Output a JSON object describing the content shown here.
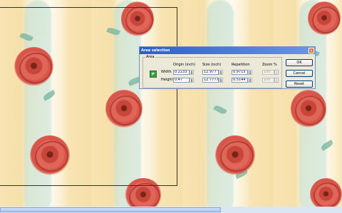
{
  "dialog": {
    "title": "Area selection",
    "close_glyph": "×",
    "group_label": "Area",
    "columns": {
      "origin": "Origin (inch)",
      "size": "Size (inch)",
      "repetition": "Repetition",
      "zoom": "Zoom %"
    },
    "rows": {
      "width": {
        "label": "Width",
        "origin": "0.2233",
        "size": "12.977",
        "repetition": "0.9715",
        "zoom": "100"
      },
      "height": {
        "label": "Height",
        "origin": "0.47",
        "size": "12.7777",
        "repetition": "0.5144",
        "zoom": "100"
      }
    },
    "buttons": {
      "ok": "OK",
      "cancel": "Cancel",
      "reset": "Reset"
    }
  },
  "icons": {
    "area": "area-select-icon",
    "spinner": "spin-arrows-icon"
  },
  "colors": {
    "titlebar": "#2f5cc9",
    "dialog_bg": "#ece9d8"
  }
}
